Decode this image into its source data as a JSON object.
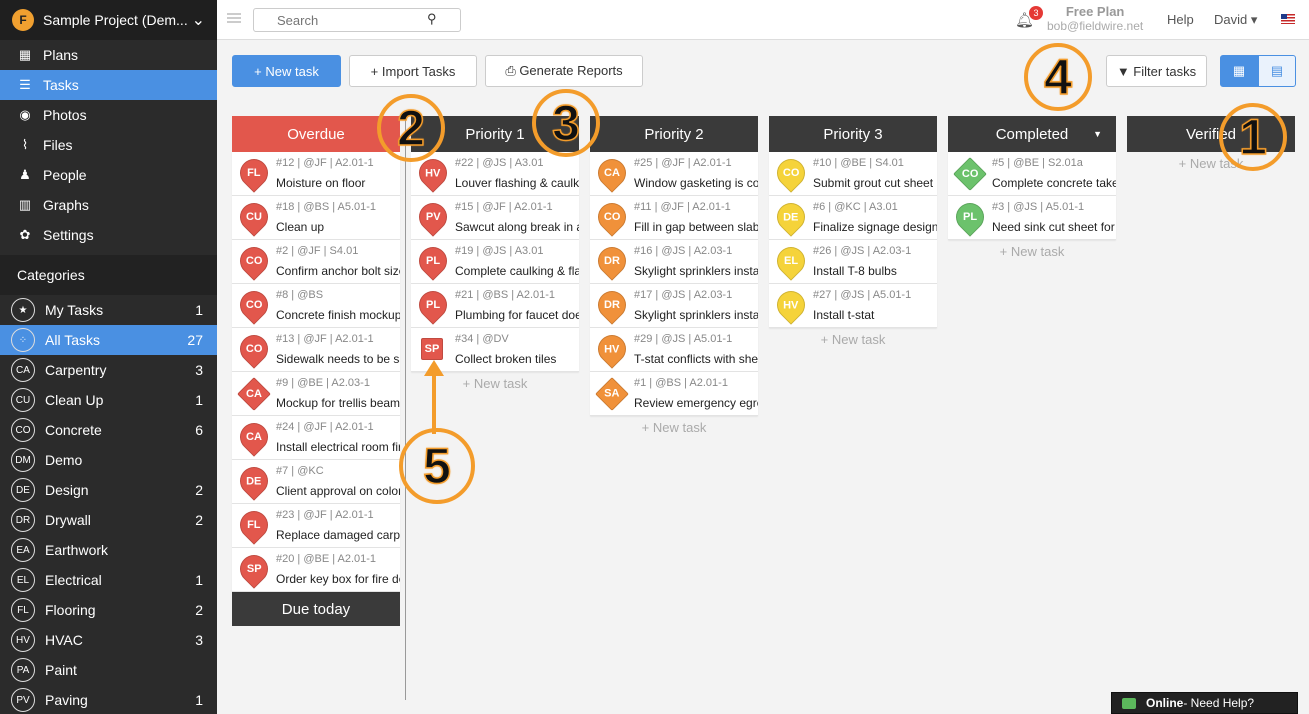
{
  "project": {
    "name": "Sample Project (Dem...",
    "logo": "F"
  },
  "nav": [
    {
      "label": "Plans",
      "icon": "plans-icon",
      "glyph": "▦",
      "active": false
    },
    {
      "label": "Tasks",
      "icon": "tasks-icon",
      "glyph": "☰",
      "active": true
    },
    {
      "label": "Photos",
      "icon": "camera-icon",
      "glyph": "◉",
      "active": false
    },
    {
      "label": "Files",
      "icon": "paperclip-icon",
      "glyph": "⌇",
      "active": false
    },
    {
      "label": "People",
      "icon": "people-icon",
      "glyph": "♟",
      "active": false
    },
    {
      "label": "Graphs",
      "icon": "bar-chart-icon",
      "glyph": "▥",
      "active": false
    },
    {
      "label": "Settings",
      "icon": "gear-icon",
      "glyph": "✿",
      "active": false
    }
  ],
  "categories_header": "Categories",
  "categories": [
    {
      "badge": "★",
      "label": "My Tasks",
      "count": "1",
      "active": false
    },
    {
      "badge": "⁘",
      "label": "All Tasks",
      "count": "27",
      "active": true
    },
    {
      "badge": "CA",
      "label": "Carpentry",
      "count": "3"
    },
    {
      "badge": "CU",
      "label": "Clean Up",
      "count": "1"
    },
    {
      "badge": "CO",
      "label": "Concrete",
      "count": "6"
    },
    {
      "badge": "DM",
      "label": "Demo",
      "count": ""
    },
    {
      "badge": "DE",
      "label": "Design",
      "count": "2"
    },
    {
      "badge": "DR",
      "label": "Drywall",
      "count": "2"
    },
    {
      "badge": "EA",
      "label": "Earthwork",
      "count": ""
    },
    {
      "badge": "EL",
      "label": "Electrical",
      "count": "1"
    },
    {
      "badge": "FL",
      "label": "Flooring",
      "count": "2"
    },
    {
      "badge": "HV",
      "label": "HVAC",
      "count": "3"
    },
    {
      "badge": "PA",
      "label": "Paint",
      "count": ""
    },
    {
      "badge": "PV",
      "label": "Paving",
      "count": "1"
    }
  ],
  "topbar": {
    "search_placeholder": "Search",
    "notifications": "3",
    "plan": "Free Plan",
    "email": "bob@fieldwire.net",
    "help": "Help",
    "user": "David ▾"
  },
  "toolbar": {
    "new_task": "+ New task",
    "import_tasks": "+ Import Tasks",
    "generate_reports": "⎙ Generate Reports",
    "filter_tasks": "▼ Filter tasks",
    "grid_view": "▦",
    "calendar_view": "▤"
  },
  "new_task_link": "+ New task",
  "columns": [
    {
      "title": "Overdue",
      "color": "#e2574c",
      "cards": [
        {
          "badge": "FL",
          "shape": "pin",
          "color": "red",
          "meta": "#12 | @JF | A2.01-1",
          "title": "Moisture on floor"
        },
        {
          "badge": "CU",
          "shape": "pin",
          "color": "red",
          "meta": "#18 | @BS | A5.01-1",
          "title": "Clean up"
        },
        {
          "badge": "CO",
          "shape": "pin",
          "color": "red",
          "meta": "#2 | @JF | S4.01",
          "title": "Confirm anchor bolt size"
        },
        {
          "badge": "CO",
          "shape": "pin",
          "color": "red",
          "meta": "#8 | @BS",
          "title": "Concrete finish mockup"
        },
        {
          "badge": "CO",
          "shape": "pin",
          "color": "red",
          "meta": "#13 | @JF | A2.01-1",
          "title": "Sidewalk needs to be saw"
        },
        {
          "badge": "CA",
          "shape": "dia",
          "color": "red",
          "meta": "#9 | @BE | A2.03-1",
          "title": "Mockup for trellis beam"
        },
        {
          "badge": "CA",
          "shape": "pin",
          "color": "red",
          "meta": "#24 | @JF | A2.01-1",
          "title": "Install electrical room fire"
        },
        {
          "badge": "DE",
          "shape": "pin",
          "color": "red",
          "meta": "#7 | @KC",
          "title": "Client approval on color"
        },
        {
          "badge": "FL",
          "shape": "pin",
          "color": "red",
          "meta": "#23 | @JF | A2.01-1",
          "title": "Replace damaged carpet"
        },
        {
          "badge": "SP",
          "shape": "pin",
          "color": "red",
          "meta": "#20 | @BE | A2.01-1",
          "title": "Order key box for fire dept"
        }
      ],
      "footer": "Due today"
    },
    {
      "title": "Priority 1",
      "cards": [
        {
          "badge": "HV",
          "shape": "pin",
          "color": "red",
          "meta": "#22 | @JS | A3.01",
          "title": "Louver flashing & caulking"
        },
        {
          "badge": "PV",
          "shape": "pin",
          "color": "red",
          "meta": "#15 | @JF | A2.01-1",
          "title": "Sawcut along break in asphalt"
        },
        {
          "badge": "PL",
          "shape": "pin",
          "color": "red",
          "meta": "#19 | @JS | A3.01",
          "title": "Complete caulking & flashing"
        },
        {
          "badge": "PL",
          "shape": "pin",
          "color": "red",
          "meta": "#21 | @BS | A2.01-1",
          "title": "Plumbing for faucet does"
        },
        {
          "badge": "SP",
          "shape": "sq",
          "color": "red",
          "meta": "#34 | @DV",
          "title": "Collect broken tiles"
        }
      ]
    },
    {
      "title": "Priority 2",
      "cards": [
        {
          "badge": "CA",
          "shape": "pin",
          "color": "org",
          "meta": "#25 | @JF | A2.01-1",
          "title": "Window gasketing is coming"
        },
        {
          "badge": "CO",
          "shape": "pin",
          "color": "org",
          "meta": "#11 | @JF | A2.01-1",
          "title": "Fill in gap between slabs"
        },
        {
          "badge": "DR",
          "shape": "pin",
          "color": "org",
          "meta": "#16 | @JS | A2.03-1",
          "title": "Skylight sprinklers install"
        },
        {
          "badge": "DR",
          "shape": "pin",
          "color": "org",
          "meta": "#17 | @JS | A2.03-1",
          "title": "Skylight sprinklers install"
        },
        {
          "badge": "HV",
          "shape": "pin",
          "color": "org",
          "meta": "#29 | @JS | A5.01-1",
          "title": "T-stat conflicts with shelf"
        },
        {
          "badge": "SA",
          "shape": "dia",
          "color": "org",
          "meta": "#1 | @BS | A2.01-1",
          "title": "Review emergency egress"
        }
      ]
    },
    {
      "title": "Priority 3",
      "cards": [
        {
          "badge": "CO",
          "shape": "pin",
          "color": "yel",
          "meta": "#10 | @BE | S4.01",
          "title": "Submit grout cut sheet"
        },
        {
          "badge": "DE",
          "shape": "pin",
          "color": "yel",
          "meta": "#6 | @KC | A3.01",
          "title": "Finalize signage design"
        },
        {
          "badge": "EL",
          "shape": "pin",
          "color": "yel",
          "meta": "#26 | @JS | A2.03-1",
          "title": "Install T-8 bulbs"
        },
        {
          "badge": "HV",
          "shape": "pin",
          "color": "yel",
          "meta": "#27 | @JS | A5.01-1",
          "title": "Install t-stat"
        }
      ]
    },
    {
      "title": "Completed",
      "caret": "▼",
      "cards": [
        {
          "badge": "CO",
          "shape": "dia",
          "color": "grn",
          "meta": "#5 | @BE | S2.01a",
          "title": "Complete concrete takeoff"
        },
        {
          "badge": "PL",
          "shape": "pin",
          "color": "grn",
          "meta": "#3 | @JS | A5.01-1",
          "title": "Need sink cut sheet for deli"
        }
      ]
    },
    {
      "title": "Verified",
      "cards": []
    }
  ],
  "callouts": [
    "1",
    "2",
    "3",
    "4",
    "5"
  ],
  "chat": {
    "status": "Online",
    "text": " - Need Help?"
  }
}
